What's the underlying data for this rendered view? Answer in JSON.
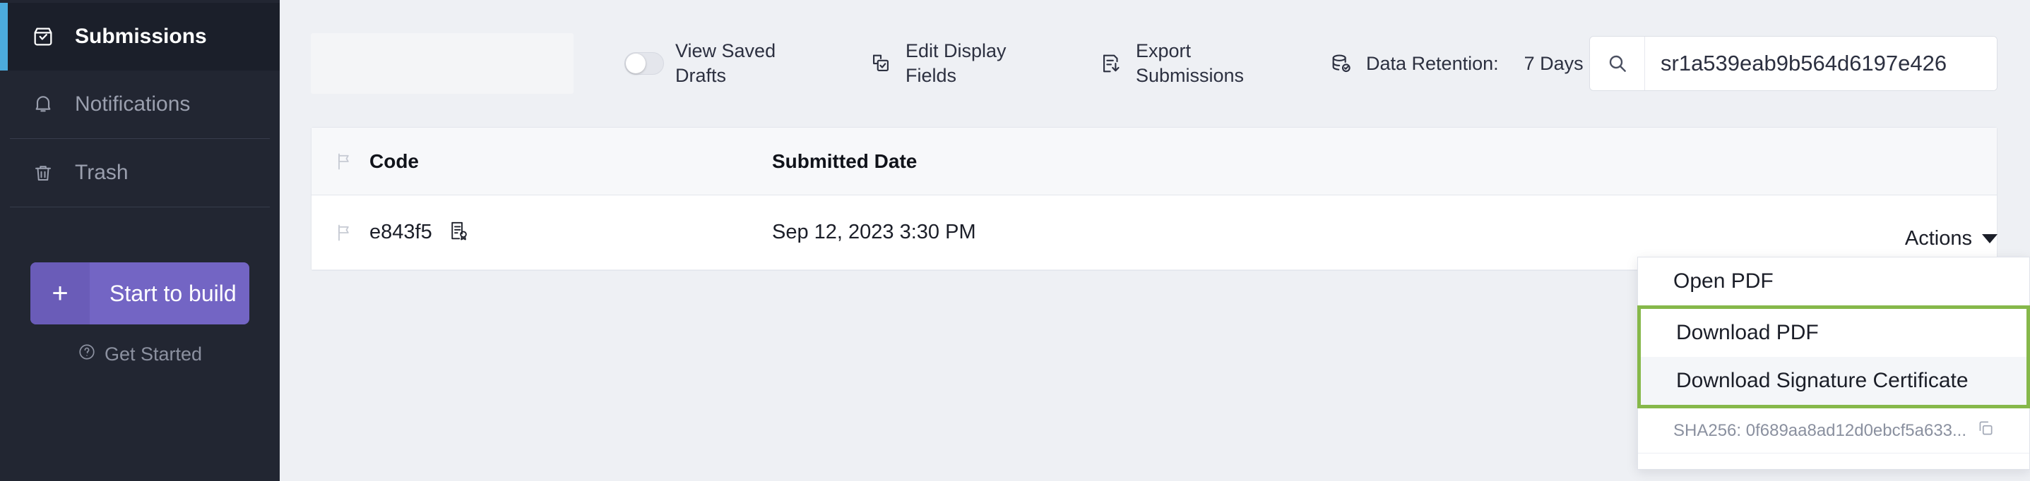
{
  "sidebar": {
    "items": [
      {
        "label": "Submissions",
        "icon": "inbox-check-icon",
        "active": true
      },
      {
        "label": "Notifications",
        "icon": "bell-icon",
        "active": false
      },
      {
        "label": "Trash",
        "icon": "trash-icon",
        "active": false
      }
    ],
    "build_button": {
      "plus": "+",
      "label": "Start to build"
    },
    "get_started": {
      "label": "Get Started",
      "icon": "question-circle-icon"
    },
    "accent_color": "#4cabdc",
    "bg_color": "#222632",
    "build_color": "#7365c4"
  },
  "toolbar": {
    "view_saved_drafts": {
      "label": "View Saved Drafts",
      "toggle_on": false
    },
    "edit_display_fields": {
      "label": "Edit Display Fields",
      "icon": "copy-check-icon"
    },
    "export_submissions": {
      "label": "Export Submissions",
      "icon": "export-down-icon"
    },
    "data_retention": {
      "label": "Data Retention:",
      "value": "7 Days",
      "icon": "database-check-icon"
    },
    "search": {
      "value": "sr1a539eab9b564d6197e426",
      "placeholder": "Search",
      "icon": "search-icon"
    }
  },
  "table": {
    "columns": [
      "Code",
      "Submitted Date"
    ],
    "rows": [
      {
        "code": "e843f5",
        "submitted_date": "Sep 12, 2023 3:30 PM",
        "flag_icon": "flag-icon",
        "cert_icon": "certificate-icon"
      }
    ]
  },
  "actions": {
    "button_label": "Actions",
    "menu": [
      {
        "label": "Open PDF",
        "highlighted": false,
        "hover": false
      },
      {
        "label": "Download PDF",
        "highlighted": true,
        "hover": false
      },
      {
        "label": "Download Signature Certificate",
        "highlighted": true,
        "hover": true
      }
    ],
    "sha": {
      "text": "SHA256: 0f689aa8ad12d0ebcf5a633...",
      "copy_icon": "copy-icon"
    },
    "highlight_color": "#86b84a"
  }
}
